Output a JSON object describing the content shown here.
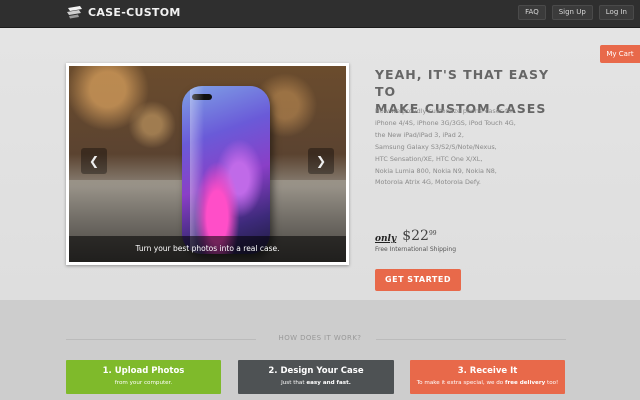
{
  "header": {
    "brand": "CASE-CUSTOM",
    "nav": [
      "FAQ",
      "Sign Up",
      "Log In"
    ]
  },
  "cart": {
    "label": "My Cart"
  },
  "hero": {
    "caption": "Turn your best photos into a real case.",
    "headline_1": "YEAH, IT'S THAT EASY TO",
    "headline_2": "MAKE CUSTOM CASES",
    "description": [
      "Now we proudly customize phone cases for",
      "iPhone 4/4S, iPhone 3G/3GS, iPod Touch 4G,",
      "the New iPad/iPad 3, iPad 2,",
      "Samsung Galaxy S3/S2/S/Note/Nexus,",
      "HTC Sensation/XE, HTC One X/XL,",
      "Nokia Lumia 800, Nokia N9, Nokia N8,",
      "Motorola Atrix 4G, Motorola Defy."
    ],
    "only": "only",
    "price": "$22",
    "cents": "99",
    "shipping": "Free International Shipping",
    "cta": "GET STARTED",
    "prev_icon": "chevron-left-icon",
    "next_icon": "chevron-right-icon"
  },
  "how": {
    "title": "HOW DOES IT WORK?",
    "steps": [
      {
        "title": "1. Upload Photos",
        "sub": "from your computer."
      },
      {
        "title": "2. Design Your Case",
        "sub_pre": "Just that ",
        "sub_bold": "easy and fast."
      },
      {
        "title": "3. Receive It",
        "sub_pre": "To make it extra special, we do ",
        "sub_bold": "free delivery",
        "sub_post": " too!"
      }
    ]
  },
  "colors": {
    "accent": "#e8694a",
    "green": "#7fba2b",
    "dark": "#4e5254",
    "topbar": "#2f2f2f"
  }
}
